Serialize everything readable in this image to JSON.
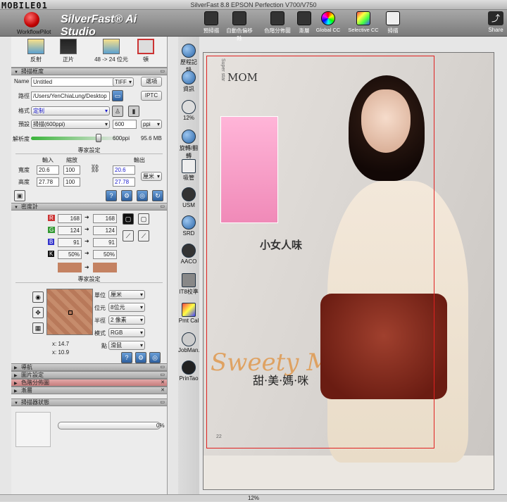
{
  "window": {
    "title": "SilverFast 8.8 EPSON Perfection V700/V750"
  },
  "watermark": "MOBILE01",
  "brand": {
    "name": "SilverFast® Ai Studio",
    "workflow": "WorkflowPilot"
  },
  "toolbar": {
    "items": [
      "預掃描",
      "自動色偏移除",
      "色階分佈圖",
      "漸層",
      "Global CC",
      "Selective CC",
      "掃描"
    ],
    "share": "Share"
  },
  "modes": [
    "反射",
    "正片",
    "48 -> 24 位元",
    "頓"
  ],
  "scan_frame": {
    "title": "掃描框度",
    "name_label": "Name",
    "name_value": "Untitled",
    "format": "TIFF",
    "options": "選項",
    "path_label": "路徑",
    "path_value": "/Users/YenChiaLung/Desktop",
    "iptc": "IPTC",
    "format_label": "格式",
    "format_value": "定制",
    "preset_label": "預設",
    "preset_value": "掃描(600ppi)",
    "ppi_value": "600",
    "ppi_unit": "ppi",
    "res_label": "解析度",
    "res_value": "600ppi",
    "size": "95.6 MB",
    "expert": "專家設定",
    "in_label": "輸入",
    "scale_label": "縮放",
    "out_label": "輸出",
    "w_label": "寬度",
    "w_in": "20.6",
    "w_scale": "100",
    "w_out": "20.6",
    "h_label": "高度",
    "h_in": "27.78",
    "h_scale": "100",
    "h_out": "27.78",
    "unit": "厘米"
  },
  "densitometer": {
    "title": "密度計",
    "rows": [
      {
        "ch": "R",
        "a": "168",
        "b": "168"
      },
      {
        "ch": "G",
        "a": "124",
        "b": "124"
      },
      {
        "ch": "B",
        "a": "91",
        "b": "91"
      },
      {
        "ch": "K",
        "a": "50%",
        "b": "50%"
      }
    ],
    "swatch_color": "#c48262",
    "expert": "專家設定",
    "unit_label": "單位",
    "unit_value": "厘米",
    "bit_label": "位元",
    "bit_value": "8位元",
    "radius_label": "半徑",
    "radius_value": "2 像素",
    "mode_label": "模式",
    "mode_value": "RGB",
    "point_label": "點",
    "point_value": "滑鼠",
    "x": "x: 14.7",
    "y": "x: 10.9"
  },
  "sections": [
    "導航",
    "圖片設定",
    "色階分佈圖",
    "漸層"
  ],
  "scanner_status": {
    "title": "掃描器狀態",
    "percent": "0%"
  },
  "tools": [
    "歷程記錄",
    "資訊",
    "12%",
    "旋轉/翻轉",
    "吸管",
    "USM",
    "SRD",
    "AACO",
    "IT8校準",
    "Pmt Cal",
    "JobMan.",
    "PrinTao"
  ],
  "status_zoom": "12%",
  "magazine": {
    "side": "Super star",
    "title": "MOM",
    "headline": "小女人味",
    "script": "Sweety Mommy",
    "cn": "甜·美·媽·咪",
    "page": "22"
  },
  "colors": {
    "accent": "#2d5f9e",
    "crop": "#e02020",
    "bag": "#7a2416"
  }
}
